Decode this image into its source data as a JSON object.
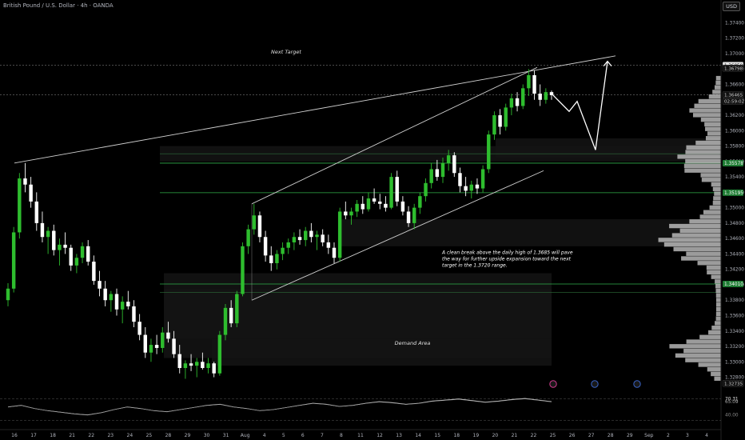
{
  "header": {
    "symbol_title": "British Pound / U.S. Dollar · 4h · OANDA",
    "currency": "USD"
  },
  "colors": {
    "background": "#000000",
    "bull": "#2ebd2e",
    "bear": "#ffffff",
    "level_line": "#2fae4a",
    "channel": "#d0d0d0",
    "zone": "#1a1a1a"
  },
  "chart_data": {
    "type": "candlestick",
    "timeframe": "4h",
    "ylim": [
      1.3265,
      1.3755
    ],
    "price_ticks": [
      "1.37400",
      "1.37200",
      "1.37000",
      "1.36800",
      "1.36600",
      "1.36400",
      "1.36200",
      "1.36000",
      "1.35800",
      "1.35600",
      "1.35400",
      "1.35200",
      "1.35000",
      "1.34800",
      "1.34600",
      "1.34400",
      "1.34200",
      "1.34000",
      "1.33800",
      "1.33600",
      "1.33400",
      "1.33200",
      "1.33000",
      "1.32800"
    ],
    "price_tick_values": [
      1.374,
      1.372,
      1.37,
      1.368,
      1.366,
      1.364,
      1.362,
      1.36,
      1.358,
      1.356,
      1.354,
      1.352,
      1.35,
      1.348,
      1.346,
      1.344,
      1.342,
      1.34,
      1.338,
      1.336,
      1.334,
      1.332,
      1.33,
      1.328
    ],
    "x_ticks": [
      "16",
      "17",
      "18",
      "21",
      "22",
      "23",
      "24",
      "25",
      "28",
      "29",
      "30",
      "31",
      "Aug",
      "4",
      "5",
      "6",
      "7",
      "8",
      "11",
      "12",
      "13",
      "14",
      "15",
      "18",
      "19",
      "20",
      "21",
      "22",
      "25",
      "26",
      "27",
      "28",
      "29",
      "Sep",
      "2",
      "3",
      "4"
    ],
    "key_levels": [
      {
        "label": "1.35578",
        "value": 1.35578
      },
      {
        "label": "1.35195",
        "value": 1.35195
      },
      {
        "label": "1.34010",
        "value": 1.3401
      }
    ],
    "other_price_labels": [
      {
        "label": "1.36850",
        "value": 1.3685
      },
      {
        "label": "1.36465",
        "value": 1.36465
      },
      {
        "label": "02:59:02",
        "value": 1.3638
      },
      {
        "label": "1.36798",
        "value": 1.3681
      },
      {
        "label": "1.32735",
        "value": 1.3272
      }
    ],
    "annotations": {
      "next_target": "Next Target",
      "demand_area": "Demand Area",
      "note_lines": [
        "A clean break above the daily high of 1.3685 will pave",
        "the way for further upside expansion toward the next",
        "target in the 1.3720 range."
      ]
    },
    "projection_path": [
      1.3648,
      1.3625,
      1.3638,
      1.3575,
      1.369
    ],
    "candles": [
      {
        "o": 1.338,
        "h": 1.3402,
        "l": 1.3372,
        "c": 1.3395
      },
      {
        "o": 1.3395,
        "h": 1.3475,
        "l": 1.339,
        "c": 1.3468
      },
      {
        "o": 1.3468,
        "h": 1.3545,
        "l": 1.346,
        "c": 1.3538
      },
      {
        "o": 1.3538,
        "h": 1.3558,
        "l": 1.352,
        "c": 1.353
      },
      {
        "o": 1.353,
        "h": 1.354,
        "l": 1.35,
        "c": 1.3508
      },
      {
        "o": 1.3508,
        "h": 1.352,
        "l": 1.347,
        "c": 1.348
      },
      {
        "o": 1.348,
        "h": 1.3495,
        "l": 1.3455,
        "c": 1.3462
      },
      {
        "o": 1.3462,
        "h": 1.3475,
        "l": 1.344,
        "c": 1.347
      },
      {
        "o": 1.347,
        "h": 1.3478,
        "l": 1.3438,
        "c": 1.3445
      },
      {
        "o": 1.3445,
        "h": 1.346,
        "l": 1.3425,
        "c": 1.3452
      },
      {
        "o": 1.3452,
        "h": 1.3468,
        "l": 1.344,
        "c": 1.3448
      },
      {
        "o": 1.3448,
        "h": 1.3452,
        "l": 1.3418,
        "c": 1.3425
      },
      {
        "o": 1.3425,
        "h": 1.344,
        "l": 1.3415,
        "c": 1.3435
      },
      {
        "o": 1.3435,
        "h": 1.3455,
        "l": 1.3428,
        "c": 1.345
      },
      {
        "o": 1.345,
        "h": 1.3458,
        "l": 1.3425,
        "c": 1.343
      },
      {
        "o": 1.343,
        "h": 1.3438,
        "l": 1.34,
        "c": 1.3405
      },
      {
        "o": 1.3405,
        "h": 1.3418,
        "l": 1.3385,
        "c": 1.3395
      },
      {
        "o": 1.3395,
        "h": 1.3405,
        "l": 1.3372,
        "c": 1.338
      },
      {
        "o": 1.338,
        "h": 1.3392,
        "l": 1.3365,
        "c": 1.3388
      },
      {
        "o": 1.3388,
        "h": 1.3395,
        "l": 1.336,
        "c": 1.3368
      },
      {
        "o": 1.3368,
        "h": 1.3385,
        "l": 1.335,
        "c": 1.3378
      },
      {
        "o": 1.3378,
        "h": 1.3392,
        "l": 1.3368,
        "c": 1.3372
      },
      {
        "o": 1.3372,
        "h": 1.338,
        "l": 1.3345,
        "c": 1.3352
      },
      {
        "o": 1.3352,
        "h": 1.3362,
        "l": 1.3328,
        "c": 1.3335
      },
      {
        "o": 1.3335,
        "h": 1.3345,
        "l": 1.3305,
        "c": 1.3312
      },
      {
        "o": 1.3312,
        "h": 1.333,
        "l": 1.33,
        "c": 1.3322
      },
      {
        "o": 1.3322,
        "h": 1.3335,
        "l": 1.331,
        "c": 1.3318
      },
      {
        "o": 1.3318,
        "h": 1.3345,
        "l": 1.3312,
        "c": 1.3338
      },
      {
        "o": 1.3338,
        "h": 1.3352,
        "l": 1.3325,
        "c": 1.333
      },
      {
        "o": 1.333,
        "h": 1.334,
        "l": 1.3305,
        "c": 1.331
      },
      {
        "o": 1.331,
        "h": 1.3322,
        "l": 1.3285,
        "c": 1.3292
      },
      {
        "o": 1.3292,
        "h": 1.3302,
        "l": 1.3278,
        "c": 1.3298
      },
      {
        "o": 1.3298,
        "h": 1.331,
        "l": 1.3288,
        "c": 1.3295
      },
      {
        "o": 1.3295,
        "h": 1.3305,
        "l": 1.328,
        "c": 1.33
      },
      {
        "o": 1.33,
        "h": 1.3312,
        "l": 1.329,
        "c": 1.3292
      },
      {
        "o": 1.3292,
        "h": 1.3305,
        "l": 1.3285,
        "c": 1.3298
      },
      {
        "o": 1.3298,
        "h": 1.33,
        "l": 1.328,
        "c": 1.3285
      },
      {
        "o": 1.3285,
        "h": 1.334,
        "l": 1.3282,
        "c": 1.3335
      },
      {
        "o": 1.3335,
        "h": 1.3375,
        "l": 1.3328,
        "c": 1.337
      },
      {
        "o": 1.337,
        "h": 1.338,
        "l": 1.3345,
        "c": 1.335
      },
      {
        "o": 1.335,
        "h": 1.3392,
        "l": 1.3345,
        "c": 1.3388
      },
      {
        "o": 1.3388,
        "h": 1.3455,
        "l": 1.3385,
        "c": 1.345
      },
      {
        "o": 1.345,
        "h": 1.3478,
        "l": 1.344,
        "c": 1.3472
      },
      {
        "o": 1.3472,
        "h": 1.3505,
        "l": 1.3465,
        "c": 1.349
      },
      {
        "o": 1.349,
        "h": 1.3495,
        "l": 1.3455,
        "c": 1.3462
      },
      {
        "o": 1.3462,
        "h": 1.347,
        "l": 1.343,
        "c": 1.3438
      },
      {
        "o": 1.3438,
        "h": 1.345,
        "l": 1.3418,
        "c": 1.3428
      },
      {
        "o": 1.3428,
        "h": 1.3445,
        "l": 1.342,
        "c": 1.344
      },
      {
        "o": 1.344,
        "h": 1.3455,
        "l": 1.3432,
        "c": 1.3448
      },
      {
        "o": 1.3448,
        "h": 1.346,
        "l": 1.344,
        "c": 1.3455
      },
      {
        "o": 1.3455,
        "h": 1.3468,
        "l": 1.3445,
        "c": 1.3462
      },
      {
        "o": 1.3462,
        "h": 1.3472,
        "l": 1.3452,
        "c": 1.3458
      },
      {
        "o": 1.3458,
        "h": 1.3475,
        "l": 1.345,
        "c": 1.347
      },
      {
        "o": 1.347,
        "h": 1.348,
        "l": 1.3455,
        "c": 1.3462
      },
      {
        "o": 1.3462,
        "h": 1.347,
        "l": 1.3445,
        "c": 1.3465
      },
      {
        "o": 1.3465,
        "h": 1.3472,
        "l": 1.345,
        "c": 1.3455
      },
      {
        "o": 1.3455,
        "h": 1.3465,
        "l": 1.344,
        "c": 1.3448
      },
      {
        "o": 1.3448,
        "h": 1.3455,
        "l": 1.3428,
        "c": 1.3435
      },
      {
        "o": 1.3435,
        "h": 1.35,
        "l": 1.343,
        "c": 1.3495
      },
      {
        "o": 1.3495,
        "h": 1.3508,
        "l": 1.3485,
        "c": 1.349
      },
      {
        "o": 1.349,
        "h": 1.35,
        "l": 1.3478,
        "c": 1.3495
      },
      {
        "o": 1.3495,
        "h": 1.351,
        "l": 1.3488,
        "c": 1.3505
      },
      {
        "o": 1.3505,
        "h": 1.3515,
        "l": 1.3492,
        "c": 1.3498
      },
      {
        "o": 1.3498,
        "h": 1.352,
        "l": 1.3495,
        "c": 1.3512
      },
      {
        "o": 1.3512,
        "h": 1.3525,
        "l": 1.3505,
        "c": 1.3508
      },
      {
        "o": 1.3508,
        "h": 1.3518,
        "l": 1.3498,
        "c": 1.3505
      },
      {
        "o": 1.3505,
        "h": 1.3515,
        "l": 1.3495,
        "c": 1.35
      },
      {
        "o": 1.35,
        "h": 1.3545,
        "l": 1.3498,
        "c": 1.354
      },
      {
        "o": 1.354,
        "h": 1.3548,
        "l": 1.3502,
        "c": 1.3508
      },
      {
        "o": 1.3508,
        "h": 1.3515,
        "l": 1.349,
        "c": 1.3495
      },
      {
        "o": 1.3495,
        "h": 1.3502,
        "l": 1.3475,
        "c": 1.348
      },
      {
        "o": 1.348,
        "h": 1.3505,
        "l": 1.3472,
        "c": 1.35
      },
      {
        "o": 1.35,
        "h": 1.352,
        "l": 1.3492,
        "c": 1.3515
      },
      {
        "o": 1.3515,
        "h": 1.3538,
        "l": 1.3508,
        "c": 1.3532
      },
      {
        "o": 1.3532,
        "h": 1.3558,
        "l": 1.3525,
        "c": 1.355
      },
      {
        "o": 1.355,
        "h": 1.3562,
        "l": 1.3535,
        "c": 1.354
      },
      {
        "o": 1.354,
        "h": 1.3565,
        "l": 1.3532,
        "c": 1.3558
      },
      {
        "o": 1.3558,
        "h": 1.3575,
        "l": 1.3548,
        "c": 1.3568
      },
      {
        "o": 1.3568,
        "h": 1.3572,
        "l": 1.354,
        "c": 1.3545
      },
      {
        "o": 1.3545,
        "h": 1.3552,
        "l": 1.352,
        "c": 1.3528
      },
      {
        "o": 1.3528,
        "h": 1.354,
        "l": 1.3515,
        "c": 1.3522
      },
      {
        "o": 1.3522,
        "h": 1.3535,
        "l": 1.3512,
        "c": 1.353
      },
      {
        "o": 1.353,
        "h": 1.3538,
        "l": 1.3518,
        "c": 1.3525
      },
      {
        "o": 1.3525,
        "h": 1.3555,
        "l": 1.352,
        "c": 1.355
      },
      {
        "o": 1.355,
        "h": 1.36,
        "l": 1.3545,
        "c": 1.3595
      },
      {
        "o": 1.3595,
        "h": 1.3625,
        "l": 1.3588,
        "c": 1.362
      },
      {
        "o": 1.362,
        "h": 1.3628,
        "l": 1.3595,
        "c": 1.3605
      },
      {
        "o": 1.3605,
        "h": 1.3635,
        "l": 1.36,
        "c": 1.363
      },
      {
        "o": 1.363,
        "h": 1.3648,
        "l": 1.362,
        "c": 1.3642
      },
      {
        "o": 1.3642,
        "h": 1.365,
        "l": 1.3625,
        "c": 1.3632
      },
      {
        "o": 1.3632,
        "h": 1.366,
        "l": 1.3628,
        "c": 1.3655
      },
      {
        "o": 1.3655,
        "h": 1.368,
        "l": 1.3645,
        "c": 1.3672
      },
      {
        "o": 1.3672,
        "h": 1.3678,
        "l": 1.364,
        "c": 1.3648
      },
      {
        "o": 1.3648,
        "h": 1.366,
        "l": 1.3632,
        "c": 1.364
      },
      {
        "o": 1.364,
        "h": 1.3655,
        "l": 1.3635,
        "c": 1.365
      },
      {
        "o": 1.365,
        "h": 1.3652,
        "l": 1.364,
        "c": 1.3646
      }
    ]
  },
  "rsi": {
    "labels": [
      "70.31",
      "65.09",
      "40.00"
    ],
    "values": [
      55,
      58,
      52,
      48,
      45,
      42,
      40,
      44,
      50,
      55,
      52,
      48,
      46,
      50,
      54,
      58,
      60,
      55,
      52,
      48,
      50,
      54,
      58,
      62,
      60,
      56,
      58,
      62,
      65,
      63,
      60,
      62,
      66,
      68,
      70,
      67,
      64,
      66,
      69,
      71,
      68,
      65
    ]
  }
}
